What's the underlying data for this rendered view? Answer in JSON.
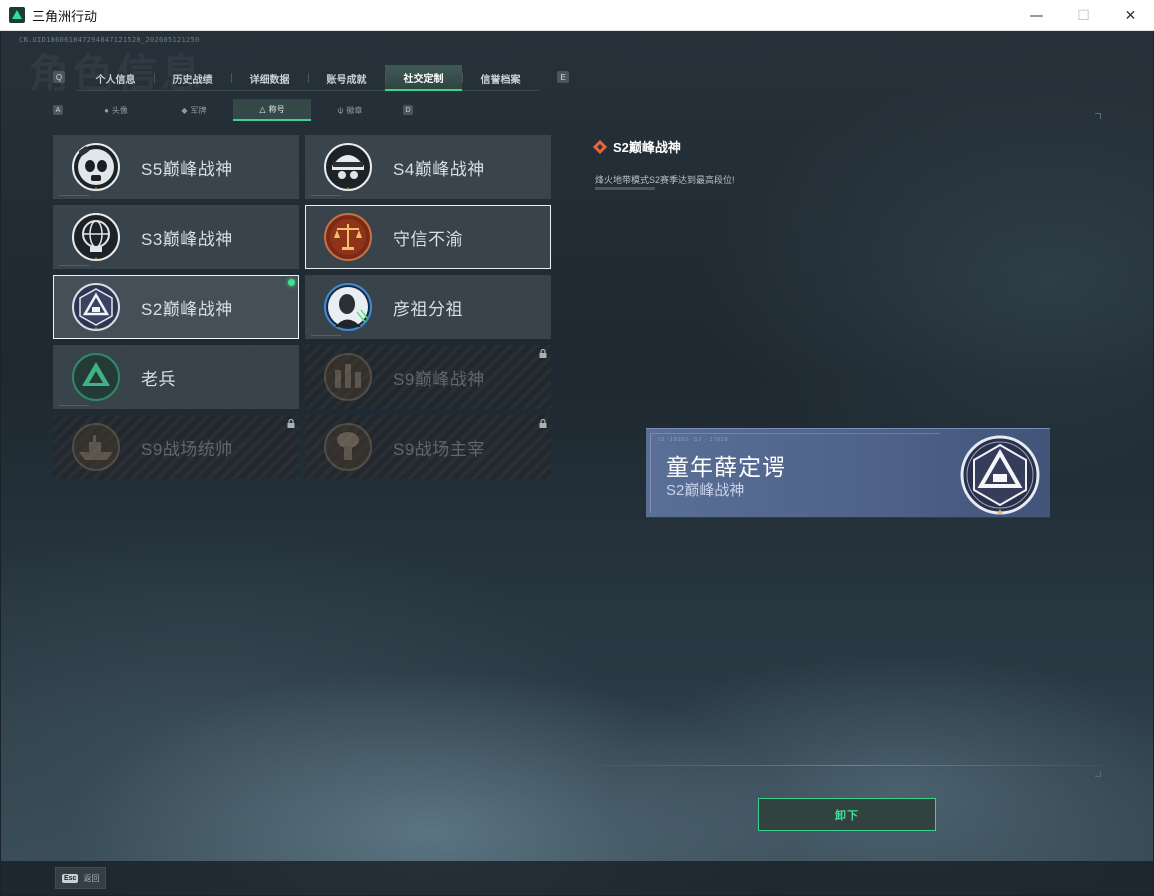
{
  "window": {
    "title": "三角洲行动",
    "controls": {
      "minimize": "—",
      "maximize": "☐",
      "close": "✕"
    }
  },
  "header": {
    "uid": "CN.UID1860618472948471215​28_202605121250",
    "ghost_title": "角色信息",
    "prev_key": "Q",
    "next_key": "E"
  },
  "tabs": [
    {
      "label": "个人信息",
      "active": false
    },
    {
      "label": "历史战绩",
      "active": false
    },
    {
      "label": "详细数据",
      "active": false
    },
    {
      "label": "账号成就",
      "active": false
    },
    {
      "label": "社交定制",
      "active": true
    },
    {
      "label": "信誉档案",
      "active": false
    }
  ],
  "subtabs": {
    "prev_key": "A",
    "next_key": "D",
    "items": [
      {
        "label": "头像",
        "icon": "person-icon",
        "active": false
      },
      {
        "label": "军牌",
        "icon": "tag-icon",
        "active": false
      },
      {
        "label": "称号",
        "icon": "title-icon",
        "active": true
      },
      {
        "label": "徽章",
        "icon": "emblem-icon",
        "active": false
      }
    ]
  },
  "titles": [
    {
      "label": "S5巅峰战神",
      "badge": "skull-gasmask-badge",
      "state": "normal"
    },
    {
      "label": "S4巅峰战神",
      "badge": "skull-helmet-badge",
      "state": "normal"
    },
    {
      "label": "S3巅峰战神",
      "badge": "skull-globe-badge",
      "state": "normal"
    },
    {
      "label": "守信不渝",
      "badge": "scales-badge",
      "state": "selected"
    },
    {
      "label": "S2巅峰战神",
      "badge": "triangle-crest-badge",
      "state": "equipped"
    },
    {
      "label": "彦祖分祖",
      "badge": "portrait-badge",
      "state": "normal"
    },
    {
      "label": "老兵",
      "badge": "delta-badge",
      "state": "normal"
    },
    {
      "label": "S9巅峰战神",
      "badge": "ruins-badge",
      "state": "locked"
    },
    {
      "label": "S9战场统帅",
      "badge": "warship-badge",
      "state": "locked"
    },
    {
      "label": "S9战场主宰",
      "badge": "explosion-badge",
      "state": "locked"
    }
  ],
  "detail": {
    "title": "S2巅峰战神",
    "description": "烽火地带模式S2赛季达到最高段位!"
  },
  "nameplate": {
    "code": "ID ·19382·  S2 ·  17628",
    "player_name": "童年薛定谔",
    "title": "S2巅峰战神"
  },
  "actions": {
    "unequip": "卸下",
    "esc_key": "Esc",
    "esc_label": "返回"
  },
  "colors": {
    "accent": "#3fe28f",
    "nameplate": "#5a6f96",
    "diamond": "#e2663a"
  }
}
